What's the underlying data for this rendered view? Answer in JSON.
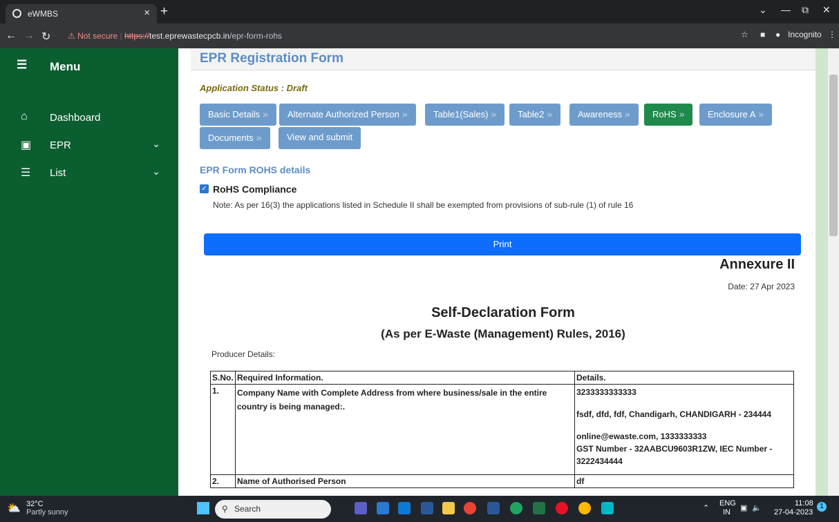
{
  "browser": {
    "tab_title": "eWMBS",
    "tab_close": "×",
    "new_tab": "+",
    "security_label": "Not secure",
    "url_scheme": "https://",
    "url_host": "test.eprewastecpcb.in",
    "url_path": "/epr-form-rohs",
    "incognito_label": "Incognito"
  },
  "sidebar": {
    "menu_label": "Menu",
    "items": [
      {
        "label": "Dashboard",
        "icon": "home-icon"
      },
      {
        "label": "EPR",
        "icon": "clipboard-user-icon"
      },
      {
        "label": "List",
        "icon": "list-icon"
      }
    ]
  },
  "page": {
    "title": "EPR Registration Form",
    "status": "Application Status : Draft",
    "steps": [
      "Basic Details",
      "Alternate Authorized Person",
      "Table1(Sales)",
      "Table2",
      "Awareness",
      "RoHS",
      "Enclosure A",
      "Documents",
      "View and submit"
    ],
    "active_step": "RoHS",
    "section_title": "EPR Form ROHS details",
    "rohs_checkbox_label": "RoHS Compliance",
    "note": "Note: As per 16(3) the applications listed in Schedule II shall be exempted from provisions of sub-rule (1) of rule 16",
    "print_label": "Print",
    "annexure": "Annexure II",
    "date": "Date: 27 Apr 2023",
    "form_title": "Self-Declaration Form",
    "form_subtitle": "(As per E-Waste (Management) Rules, 2016)",
    "producer_details": "Producer Details:"
  },
  "table": {
    "headers": [
      "S.No.",
      "Required Information.",
      "Details."
    ],
    "rows": [
      {
        "sno": "1.",
        "info": "Company Name with Complete Address from where business/sale in the entire country is being managed:.",
        "details": [
          "3233333333333",
          "fsdf, dfd, fdf, Chandigarh, CHANDIGARH - 234444",
          "online@ewaste.com, 1333333333",
          "GST Number - 32AABCU9603R1ZW, IEC Number - 3222434444"
        ]
      },
      {
        "sno": "2.",
        "info": "Name of Authorised Person",
        "details": [
          "df"
        ]
      }
    ]
  },
  "taskbar": {
    "temp": "32°C",
    "weather": "Partly sunny",
    "search_placeholder": "Search",
    "lang": "ENG",
    "region": "IN",
    "time": "11:08",
    "date": "27-04-2023"
  },
  "colors": {
    "sidebar": "#0b5e30",
    "step": "#6d9ccc",
    "step_active": "#1e8a4c",
    "print": "#0d6efd"
  }
}
